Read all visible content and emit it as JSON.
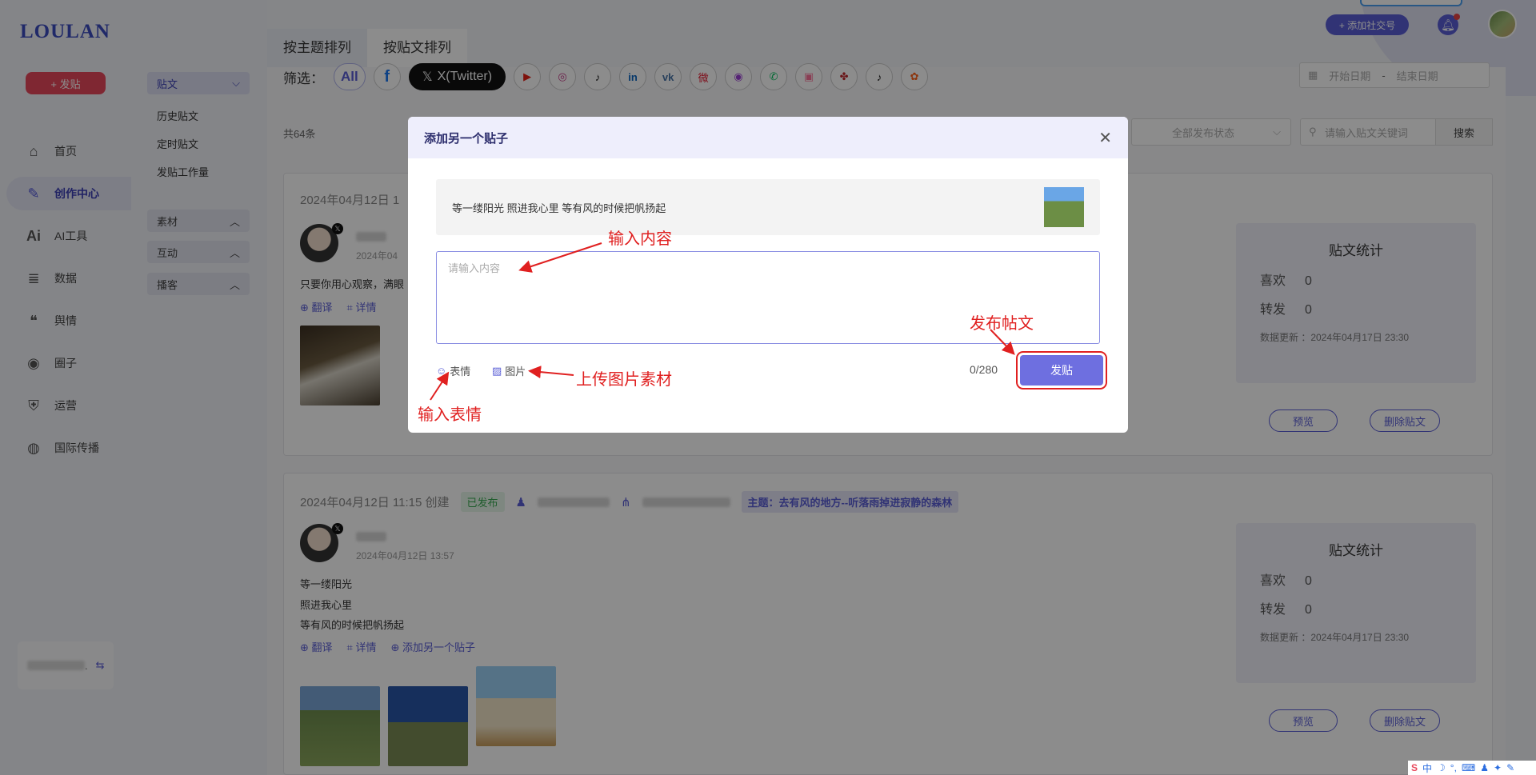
{
  "app": {
    "logo": "LOULAN",
    "post_button": "+ 发贴"
  },
  "nav": [
    {
      "label": "首页",
      "icon": "home-icon",
      "glyph": "⌂"
    },
    {
      "label": "创作中心",
      "icon": "palette-icon",
      "glyph": "✎",
      "active": true
    },
    {
      "label": "AI工具",
      "icon": "ai-icon",
      "glyph": "Ai"
    },
    {
      "label": "数据",
      "icon": "database-icon",
      "glyph": "≣"
    },
    {
      "label": "舆情",
      "icon": "quote-icon",
      "glyph": "❝"
    },
    {
      "label": "圈子",
      "icon": "compass-icon",
      "glyph": "◉"
    },
    {
      "label": "运营",
      "icon": "shield-icon",
      "glyph": "⛨"
    },
    {
      "label": "国际传播",
      "icon": "globe-icon",
      "glyph": "◍"
    }
  ],
  "account": {
    "suffix": ".",
    "switch_icon": "switch-icon"
  },
  "submenu": {
    "posts_head": "贴文",
    "posts_links": [
      "历史贴文",
      "定时贴文",
      "发贴工作量"
    ],
    "material_head": "素材",
    "interact_head": "互动",
    "broadcast_head": "播客"
  },
  "topbar": {
    "add_account": "+ 添加社交号"
  },
  "tabs": [
    "按主题排列",
    "按贴文排列"
  ],
  "filter": {
    "label": "筛选：",
    "all": "All",
    "x_label": "X(Twitter)",
    "platforms": [
      {
        "glyph": "f",
        "color": "#1877f2"
      },
      {
        "glyph": "▶",
        "color": "#e62117"
      },
      {
        "glyph": "◎",
        "color": "#c13584"
      },
      {
        "glyph": "♪",
        "color": "#111111"
      },
      {
        "glyph": "in",
        "color": "#0a66c2"
      },
      {
        "glyph": "vk",
        "color": "#4a76a8"
      },
      {
        "glyph": "微",
        "color": "#e6162d"
      },
      {
        "glyph": "◉",
        "color": "#9b3fd6"
      },
      {
        "glyph": "✆",
        "color": "#07c160"
      },
      {
        "glyph": "▣",
        "color": "#fb7299"
      },
      {
        "glyph": "✤",
        "color": "#c0272d"
      },
      {
        "glyph": "♪",
        "color": "#111111"
      },
      {
        "glyph": "✿",
        "color": "#ff5f15"
      }
    ],
    "date_start": "开始日期",
    "date_sep": "-",
    "date_end": "结束日期"
  },
  "list": {
    "total": "共64条",
    "status_placeholder": "全部发布状态",
    "search_placeholder": "请输入贴文关键词",
    "search_button": "搜索"
  },
  "cards": [
    {
      "date": "2024年04月12日 1",
      "subdate": "2024年04",
      "text": [
        "只要你用心观察，满眼"
      ],
      "actions": [
        "翻译",
        "详情"
      ],
      "stats": {
        "title": "贴文统计",
        "likes_label": "喜欢",
        "likes": "0",
        "shares_label": "转发",
        "shares": "0",
        "updated": "数据更新 ：2024年04月17日 23:30"
      },
      "preview": "预览",
      "delete": "删除贴文"
    },
    {
      "date": "2024年04月12日 11:15 创建",
      "status": "已发布",
      "topic": "主题：去有风的地方--听落雨掉进寂静的森林",
      "subdate": "2024年04月12日 13:57",
      "text": [
        "等一缕阳光",
        "照进我心里",
        "等有风的时候把帆扬起"
      ],
      "actions": [
        "翻译",
        "详情",
        "添加另一个贴子"
      ],
      "stats": {
        "title": "贴文统计",
        "likes_label": "喜欢",
        "likes": "0",
        "shares_label": "转发",
        "shares": "0",
        "updated": "数据更新 ：2024年04月17日 23:30"
      },
      "preview": "预览",
      "delete": "删除贴文"
    }
  ],
  "modal": {
    "title": "添加另一个贴子",
    "ref_text": "等一缕阳光 照进我心里 等有风的时候把帆扬起",
    "placeholder": "请输入内容",
    "emoji_label": "表情",
    "image_label": "图片",
    "counter": "0/280",
    "publish": "发贴"
  },
  "annotations": {
    "input_content": "输入内容",
    "publish_post": "发布帖文",
    "upload_image": "上传图片素材",
    "input_emoji": "输入表情",
    "color": "#e02020"
  },
  "tray": {
    "ime_label": "中"
  }
}
